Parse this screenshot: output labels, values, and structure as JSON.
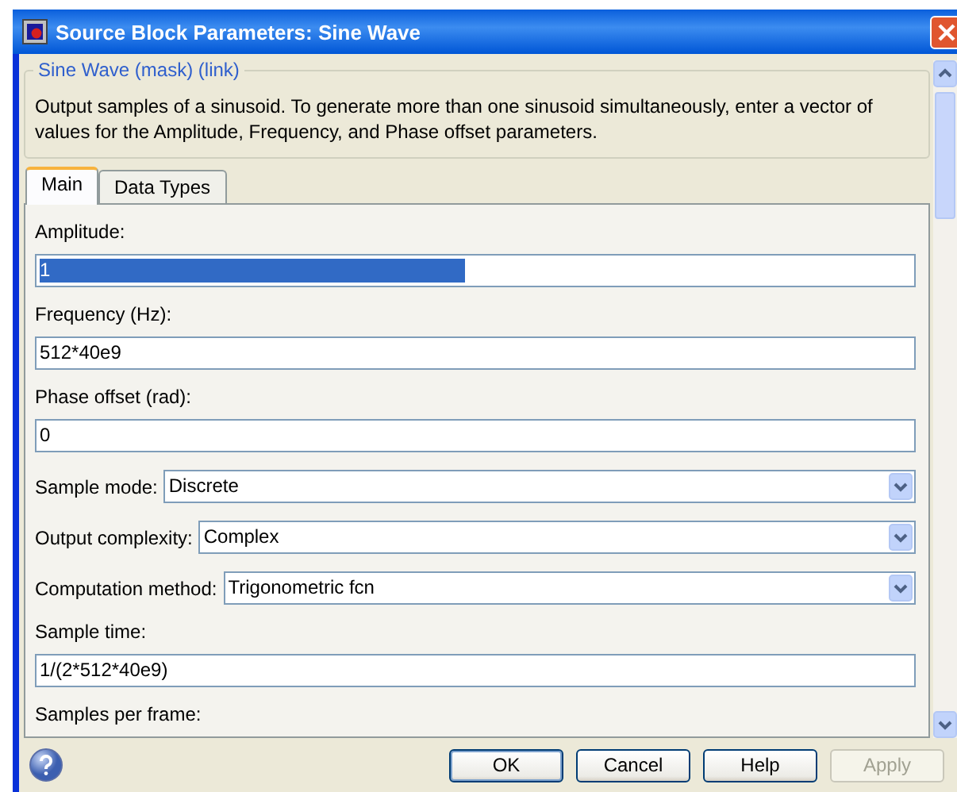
{
  "window": {
    "title": "Source Block Parameters: Sine Wave"
  },
  "group": {
    "title": "Sine Wave (mask) (link)",
    "description": "Output samples of a sinusoid.  To generate more than one sinusoid simultaneously, enter a vector of values for the Amplitude, Frequency, and Phase offset parameters."
  },
  "tabs": [
    {
      "label": "Main",
      "selected": true
    },
    {
      "label": "Data Types",
      "selected": false
    }
  ],
  "parameters": [
    {
      "kind": "text",
      "label": "Amplitude:",
      "value": "1",
      "text_selected": true
    },
    {
      "kind": "text",
      "label": "Frequency (Hz):",
      "value": "512*40e9",
      "text_selected": false
    },
    {
      "kind": "text",
      "label": "Phase offset (rad):",
      "value": "0",
      "text_selected": false
    },
    {
      "kind": "dropdown",
      "label": "Sample mode:",
      "value": "Discrete"
    },
    {
      "kind": "dropdown",
      "label": "Output complexity:",
      "value": "Complex"
    },
    {
      "kind": "dropdown",
      "label": "Computation method:",
      "value": "Trigonometric fcn"
    },
    {
      "kind": "text",
      "label": "Sample time:",
      "value": "1/(2*512*40e9)",
      "text_selected": false
    },
    {
      "kind": "label",
      "label": "Samples per frame:"
    }
  ],
  "buttons": [
    {
      "label": "OK",
      "disabled": false,
      "default": true
    },
    {
      "label": "Cancel",
      "disabled": false,
      "default": false
    },
    {
      "label": "Help",
      "disabled": false,
      "default": false
    },
    {
      "label": "Apply",
      "disabled": true,
      "default": false
    }
  ]
}
